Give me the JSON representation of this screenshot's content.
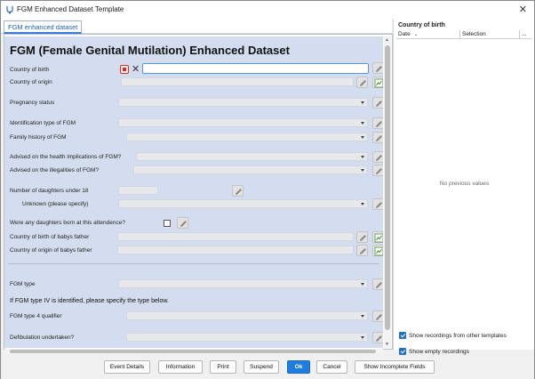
{
  "window": {
    "title": "FGM Enhanced Dataset Template",
    "close_glyph": "✕",
    "icon": "stethoscope-icon"
  },
  "tab": {
    "label": "FGM enhanced dataset"
  },
  "form": {
    "title": "FGM (Female Genital Mutilation) Enhanced Dataset",
    "fields": {
      "country_of_birth": {
        "label": "Country of birth",
        "value": ""
      },
      "country_of_origin": {
        "label": "Country of origin"
      },
      "pregnancy_status": {
        "label": "Pregnancy status"
      },
      "identification_type": {
        "label": "Identification type of FGM"
      },
      "family_history": {
        "label": "Family history of FGM"
      },
      "advised_health": {
        "label": "Advised on the health implications of FGM?"
      },
      "advised_illegalities": {
        "label": "Advised on the illegalities of FGM?"
      },
      "number_of_daughters": {
        "label": "Number of daughters under 18"
      },
      "unknown_specify": {
        "label": "Unknown (please specify)"
      },
      "daughters_born": {
        "label": "Were any daughters born at this attendence?"
      },
      "father_birth": {
        "label": "Country of birth of babys father"
      },
      "father_origin": {
        "label": "Country of origin of babys father"
      },
      "fgm_type": {
        "label": "FGM type"
      },
      "type_iv_note": {
        "text": "If FGM type IV is identified, please specify the type below."
      },
      "fgm_type4_qualifier": {
        "label": "FGM type 4 qualifier"
      },
      "defibulation": {
        "label": "Defibulation undertaken?"
      }
    }
  },
  "side_panel": {
    "title": "Country of birth",
    "columns": {
      "date": "Date",
      "selection": "Selection",
      "more": "..."
    },
    "empty_text": "No previous values",
    "options": {
      "other_templates": {
        "label": "Show recordings from other templates",
        "checked": true
      },
      "empty_recordings": {
        "label": "Show empty recordings",
        "checked": true
      }
    }
  },
  "footer": {
    "event_details": "Event Details",
    "information": "Information",
    "print": "Print",
    "suspend": "Suspend",
    "ok": "Ok",
    "cancel": "Cancel",
    "show_incomplete": "Show Incomplete Fields"
  },
  "colors": {
    "accent": "#1f7de0",
    "form_bg": "#d4ddf0",
    "stop": "#c0392b"
  }
}
